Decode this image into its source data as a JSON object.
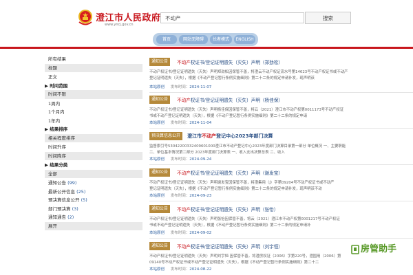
{
  "header": {
    "site_title": "澄江市人民政府",
    "site_url": "www.yncj.gov.cn",
    "search_value": "不动产",
    "search_button": "搜索",
    "nav": [
      "首页",
      "网站无障碍",
      "长者模式",
      "ENGLISH"
    ]
  },
  "sidebar": {
    "filters": [
      {
        "label": "所有结果",
        "grey": false
      },
      {
        "label": "标题",
        "grey": true
      },
      {
        "label": "正文",
        "grey": false
      }
    ],
    "time_head": "时间范围",
    "time_options": [
      "时间不限",
      "1周内",
      "1个月内",
      "1年内"
    ],
    "sort_head": "结果排序",
    "sort_options": [
      "相关程度排序",
      "时间升序",
      "时间降序"
    ],
    "category_head": "结果分类",
    "categories": [
      {
        "label": "全部",
        "count": ""
      },
      {
        "label": "通知公告",
        "count": "(99)"
      },
      {
        "label": "最新公开信息",
        "count": "(25)"
      },
      {
        "label": "预决算信息公开",
        "count": "(5)"
      },
      {
        "label": "部门预决算",
        "count": "(3)"
      },
      {
        "label": "通知通告",
        "count": "(2)"
      },
      {
        "label": "展开",
        "count": ""
      }
    ]
  },
  "results": [
    {
      "tag": "通知公告",
      "title_pre": "",
      "keyword": "不动产",
      "title_post": "权证书/登记证明遗失（灭失）声明（郑劲松）",
      "summary_lines": [
        "不动产权证书/登记证明遗失（灭失）声明郑劲松因保管不善，将澄云不动产权证流水号第14623号不动产权证书或不动产",
        "登记证明遗失（灭失），根据《不动产登记暂行条例实施细则》第二十二条的规定申请补发，现声明该"
      ],
      "source": "本站原创",
      "date_label": "发布时间：",
      "date": "2024-11-07"
    },
    {
      "tag": "通知公告",
      "title_pre": "",
      "keyword": "不动产",
      "title_post": "权证书/登记证明遗失（灭失）声明（杨佳保）",
      "summary_lines": [
        "不动产权证书/登记证明遗失（灭失）声明杨佳保因保管不善，将云（2021）澄江市不动产权第0011173号不动产权证",
        "书或不动产登记证明遗失（灭失），根据《不动产登记暂行条例实施细则》第二十二条的规定申请"
      ],
      "source": "本站原创",
      "date_label": "发布时间：",
      "date": "2024-11-04"
    },
    {
      "tag": "预决算信息公开",
      "title_pre": "澄江市",
      "keyword": "不动产",
      "title_post": "登记中心2023年部门决算",
      "bold": true,
      "summary_lines": [
        "监督索引号53042200332409601000澄江市不动产登记中心2023年度部门决算目录第一部分 单位概况 一、主要职能",
        "二、单位基本情况第二部分 2023年度部门决算表 一、收入支出决算总表 二、收入"
      ],
      "source": "本站原创",
      "date_label": "发布时间：",
      "date": "2024-09-24"
    },
    {
      "tag": "通知公告",
      "title_pre": "",
      "keyword": "不动产",
      "title_post": "权证书/登记证明遗失（灭失）声明（谢发宝）",
      "summary_lines": [
        "不动产权证书/登记证明遗失（灭失）声明谢发宝因保管不善，将澄集用（J）字第09204号不动产权证书或不动产",
        "登记证明遗失（灭失），根据《不动产登记暂行条例实施细则》第二十二条的规定申请补发，现声明该不动"
      ],
      "source": "本站原创",
      "date_label": "发布时间：",
      "date": "2024-09-23"
    },
    {
      "tag": "通知公告",
      "title_pre": "",
      "keyword": "不动产",
      "title_post": "权证书/登记证明遗失（灭失）声明（张怡）",
      "summary_lines": [
        "不动产权证书/登记证明遗失（灭失）声明张怡因保管不善，将云（2021）澄江市不动产权第0001217号不动产权证",
        "书或不动产登记证明遗失（灭失），根据《不动产登记暂行条例实施细则》第二十二条的规定申请补"
      ],
      "source": "本站原创",
      "date_label": "发布时间：",
      "date": "2024-09-02"
    },
    {
      "tag": "通知公告",
      "title_pre": "",
      "keyword": "不动产",
      "title_post": "权证书/登记证明遗失（灭失）声明（刘宇恒）",
      "summary_lines": [
        "不动产权证书/登记证明遗失（灭失）声明刘宇恒 因保管不善，将澄房权证（2006）字第220号，澄国用（2006）第",
        "09140号不动产权证书或不动产登记证明遗失（灭失），根据《不动产登记暂行条例实施细则》第二十二"
      ],
      "source": "本站原创",
      "date_label": "发布时间：",
      "date": "2024-08-22"
    }
  ],
  "watermark": "房管助手",
  "colors": {
    "brand_red": "#c8161d",
    "tag": "#b5893a",
    "link": "#2a4f85",
    "nav": "#b9cfe6"
  }
}
